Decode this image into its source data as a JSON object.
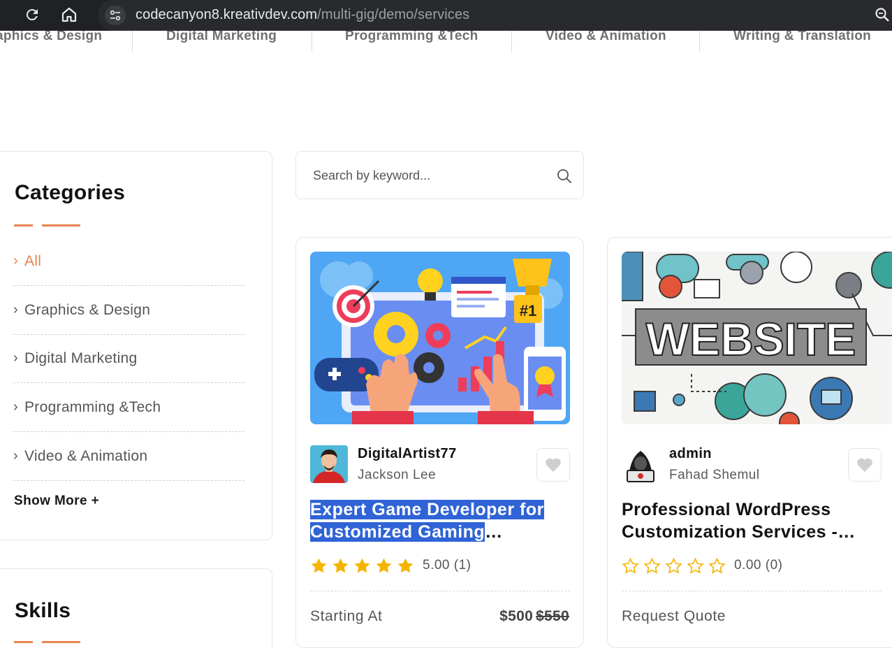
{
  "browser": {
    "url_host": "codecanyon8.kreativdev.com",
    "url_path": "/multi-gig/demo/services"
  },
  "category_strip": [
    "aphics & Design",
    "Digital Marketing",
    "Programming &Tech",
    "Video & Animation",
    "Writing & Translation"
  ],
  "sidebar": {
    "categories_heading": "Categories",
    "categories": [
      {
        "label": "All",
        "active": true
      },
      {
        "label": "Graphics & Design",
        "active": false
      },
      {
        "label": "Digital Marketing",
        "active": false
      },
      {
        "label": "Programming &Tech",
        "active": false
      },
      {
        "label": "Video & Animation",
        "active": false
      }
    ],
    "show_more": "Show More +",
    "skills_heading": "Skills"
  },
  "search": {
    "placeholder": "Search by keyword..."
  },
  "services": [
    {
      "username": "DigitalArtist77",
      "seller_name": "Jackson Lee",
      "title_highlighted": "Expert Game Developer for Customized Gaming",
      "title_rest": "…",
      "rating_stars": 5,
      "rating_text": "5.00 (1)",
      "price_label": "Starting At",
      "price": "$500",
      "price_old": "$550"
    },
    {
      "username": "admin",
      "seller_name": "Fahad Shemul",
      "title": "Professional WordPress Customization Services -…",
      "thumbnail_text": "WEBSITE",
      "rating_stars": 0,
      "rating_text": "0.00 (0)",
      "price_label": "Request Quote"
    }
  ],
  "colors": {
    "accent": "#e6844d",
    "star": "#f5b400",
    "highlight": "#2f63d6"
  }
}
